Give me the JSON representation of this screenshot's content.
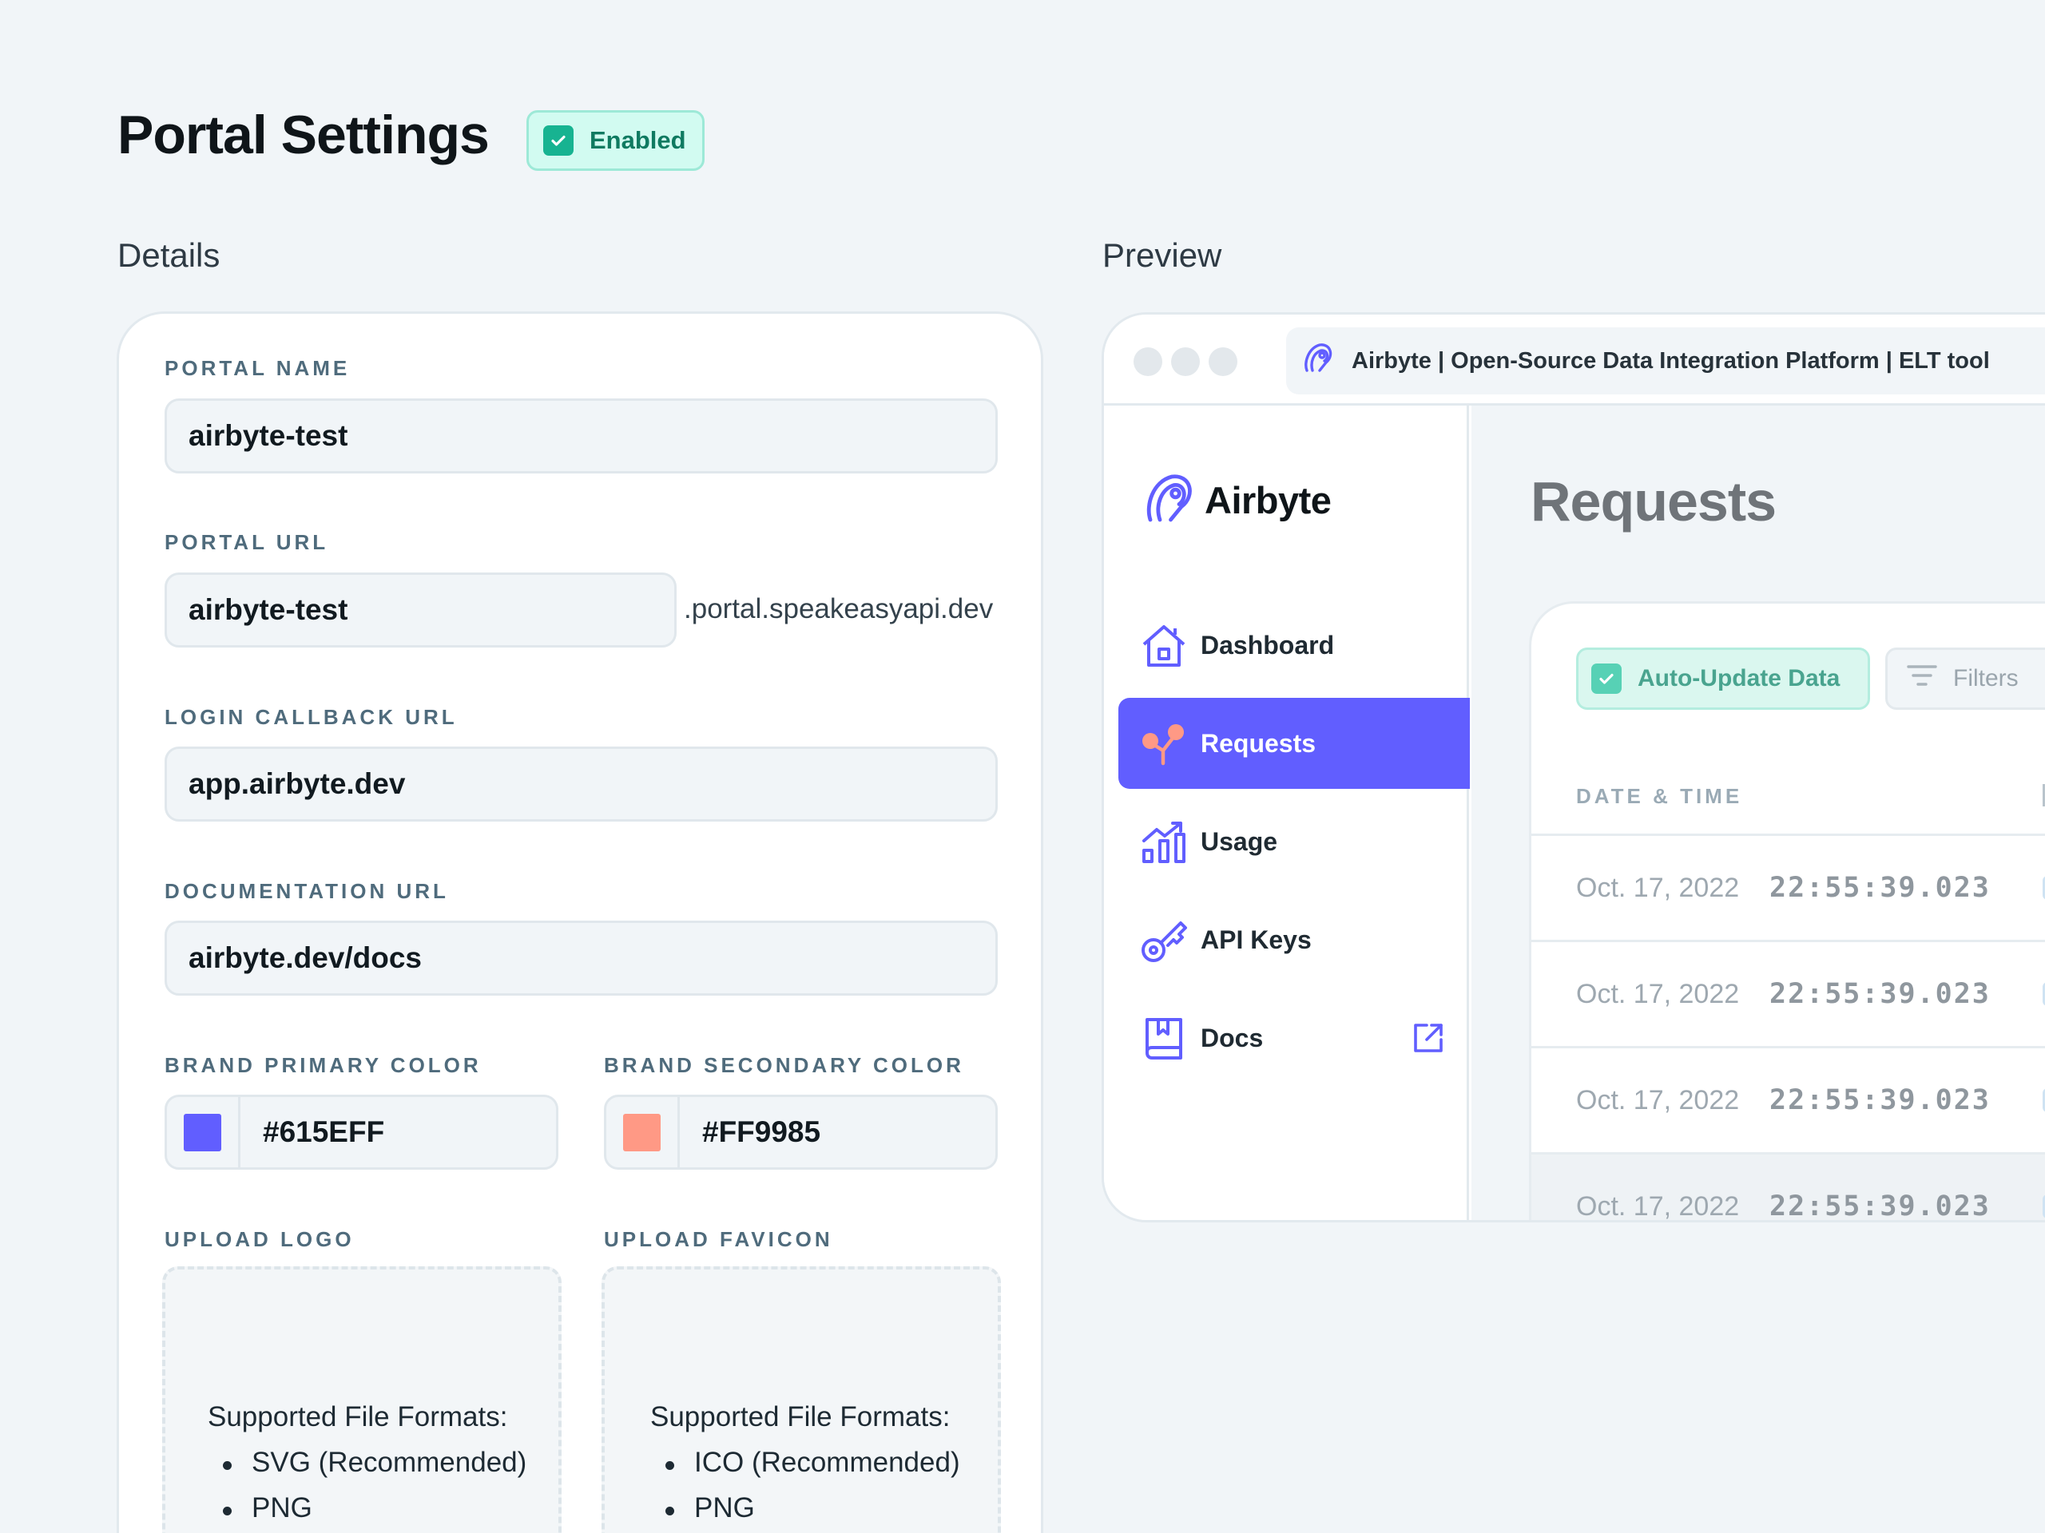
{
  "header": {
    "title": "Portal Settings",
    "status_badge": "Enabled"
  },
  "sections": {
    "details": "Details",
    "preview": "Preview"
  },
  "form": {
    "portal_name": {
      "label": "PORTAL NAME",
      "value": "airbyte-test"
    },
    "portal_url": {
      "label": "PORTAL URL",
      "value": "airbyte-test",
      "suffix": ".portal.speakeasyapi.dev"
    },
    "login_callback_url": {
      "label": "LOGIN CALLBACK URL",
      "value": "app.airbyte.dev"
    },
    "documentation_url": {
      "label": "DOCUMENTATION URL",
      "value": "airbyte.dev/docs"
    },
    "brand_primary_color": {
      "label": "BRAND PRIMARY COLOR",
      "value": "#615EFF"
    },
    "brand_secondary_color": {
      "label": "BRAND SECONDARY COLOR",
      "value": "#FF9985"
    },
    "upload_logo": {
      "label": "UPLOAD LOGO",
      "formats_title": "Supported File Formats:",
      "formats": [
        "SVG (Recommended)",
        "PNG"
      ]
    },
    "upload_favicon": {
      "label": "UPLOAD FAVICON",
      "formats_title": "Supported File Formats:",
      "formats": [
        "ICO (Recommended)",
        "PNG"
      ]
    }
  },
  "preview": {
    "browser_tab_title": "Airbyte | Open-Source Data Integration Platform | ELT tool",
    "brand_name": "Airbyte",
    "nav": [
      {
        "label": "Dashboard",
        "icon": "house-icon",
        "active": false
      },
      {
        "label": "Requests",
        "icon": "requests-icon",
        "active": true
      },
      {
        "label": "Usage",
        "icon": "chart-growth-icon",
        "active": false
      },
      {
        "label": "API Keys",
        "icon": "key-icon",
        "active": false
      },
      {
        "label": "Docs",
        "icon": "book-icon",
        "active": false,
        "external": true
      }
    ],
    "page_title": "Requests",
    "auto_update_label": "Auto-Update Data",
    "filters_label": "Filters",
    "table": {
      "columns": [
        "DATE & TIME"
      ],
      "rows": [
        {
          "date": "Oct. 17, 2022",
          "time": "22:55:39.023"
        },
        {
          "date": "Oct. 17, 2022",
          "time": "22:55:39.023"
        },
        {
          "date": "Oct. 17, 2022",
          "time": "22:55:39.023"
        },
        {
          "date": "Oct. 17, 2022",
          "time": "22:55:39.023"
        }
      ]
    }
  },
  "colors": {
    "accent": "#615EFF",
    "secondary": "#FF9985",
    "success": "#17B391",
    "background": "#F1F5F8"
  }
}
